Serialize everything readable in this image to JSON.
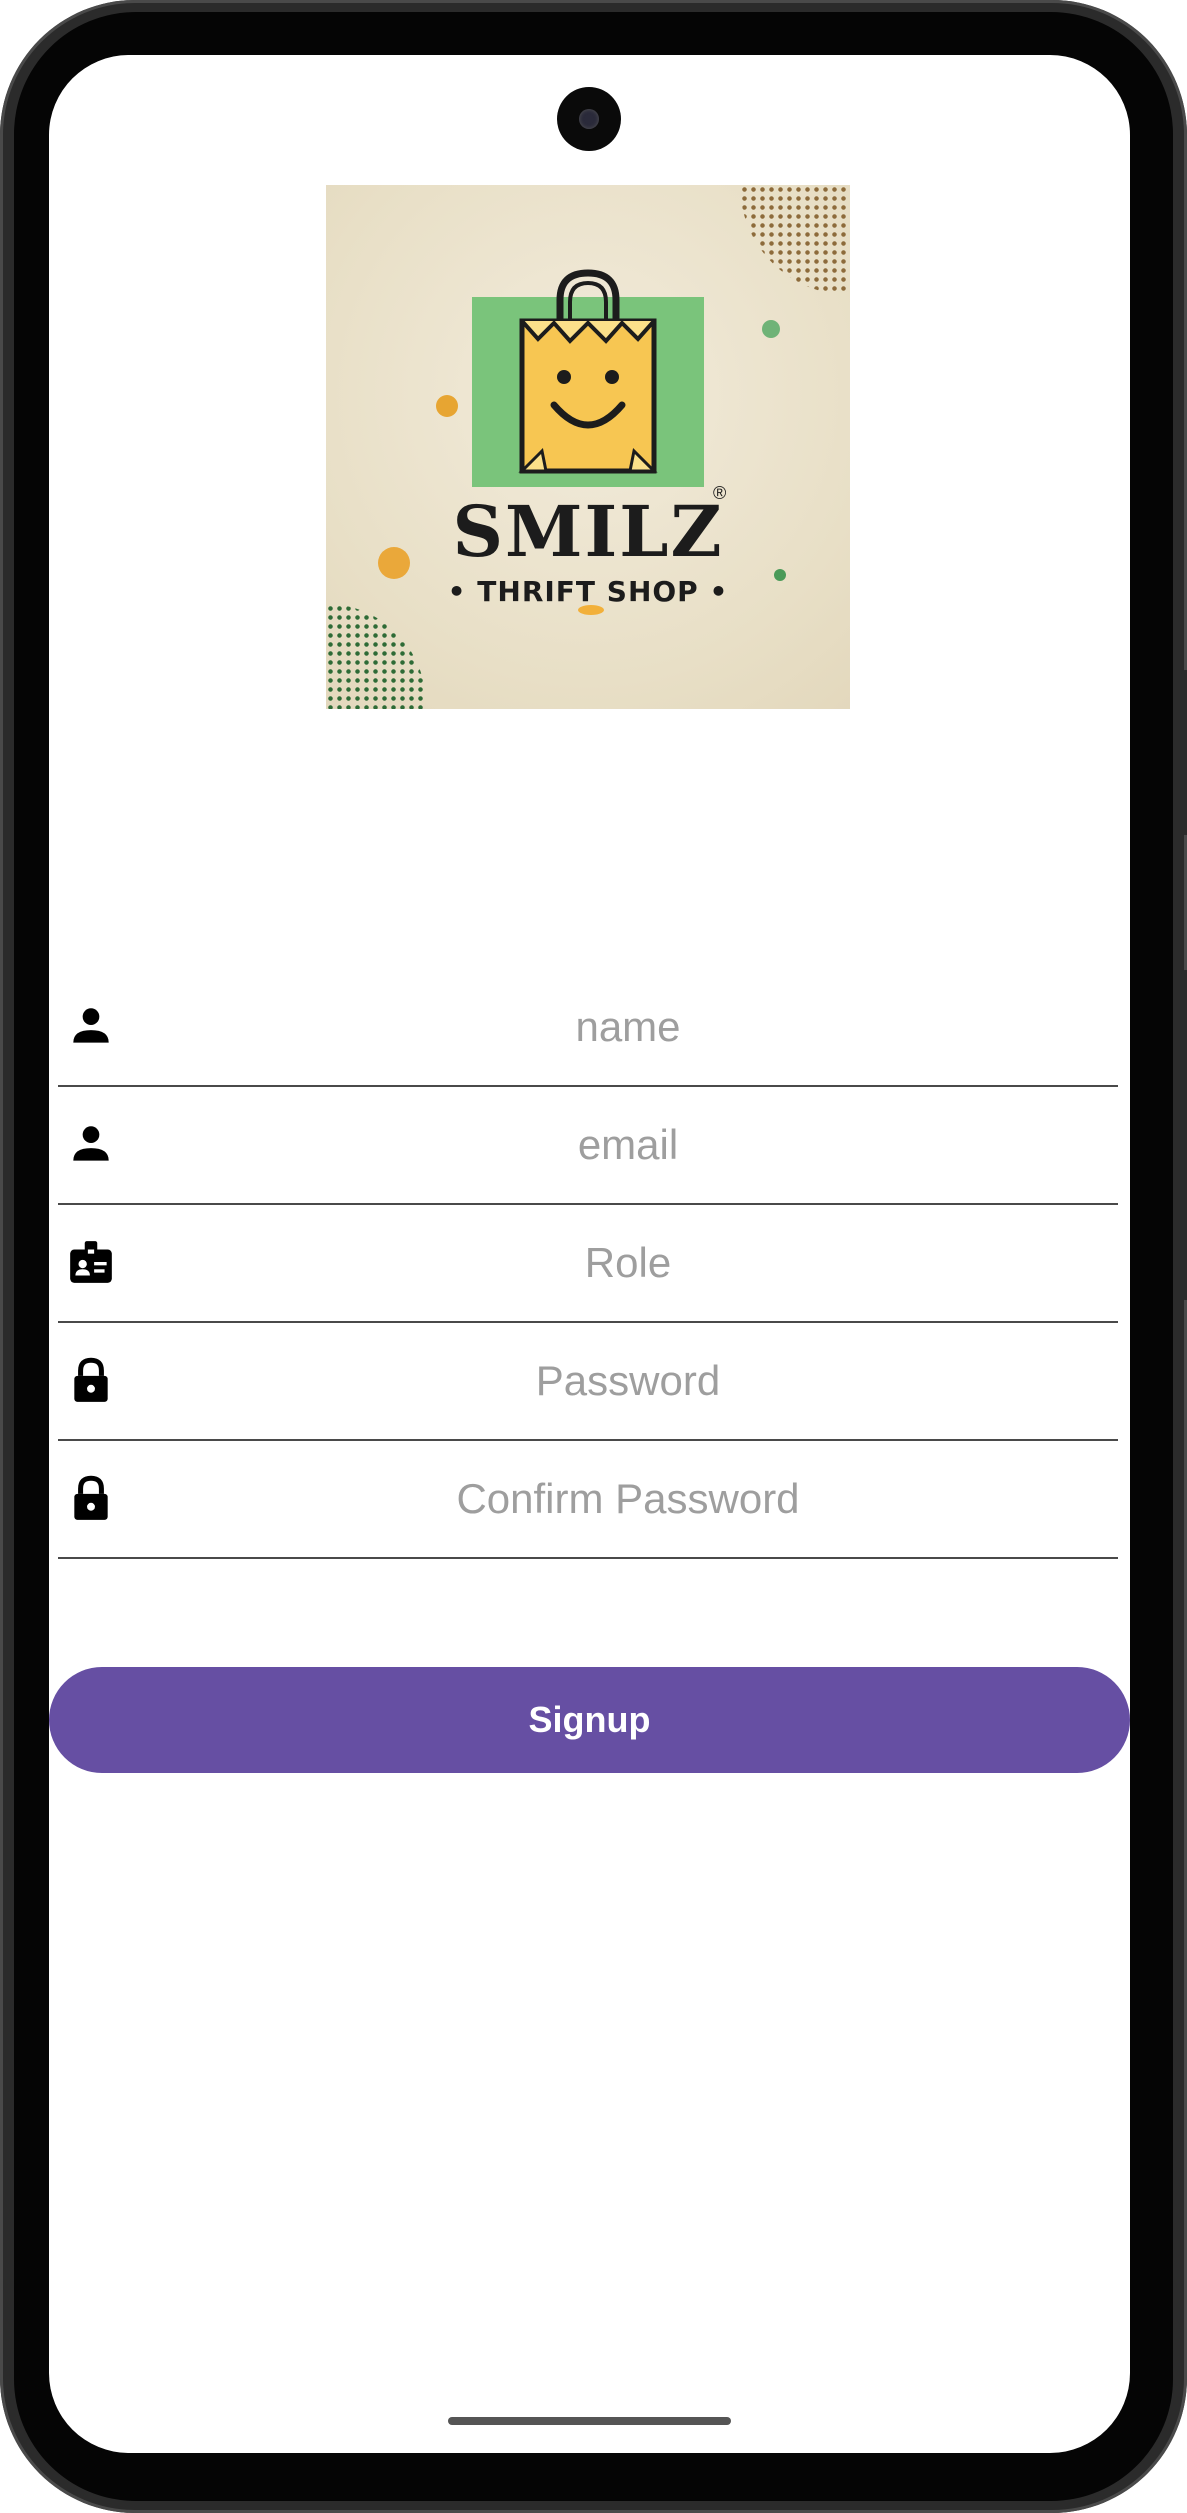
{
  "logo": {
    "brand": "SMILZ",
    "registered": "®",
    "subtitle": "• THRIFT SHOP •"
  },
  "form": {
    "name_placeholder": "name",
    "email_placeholder": "email",
    "role_placeholder": "Role",
    "password_placeholder": "Password",
    "confirm_password_placeholder": "Confirm Password"
  },
  "signup_label": "Signup",
  "colors": {
    "accent": "#664fa3",
    "logo_background": "#e8dfc6",
    "logo_green": "#7ac47b",
    "logo_bag": "#f7c652"
  },
  "icons": {
    "name": "person-icon",
    "email": "person-icon",
    "role": "id-badge-icon",
    "password": "lock-icon",
    "confirm_password": "lock-icon"
  }
}
